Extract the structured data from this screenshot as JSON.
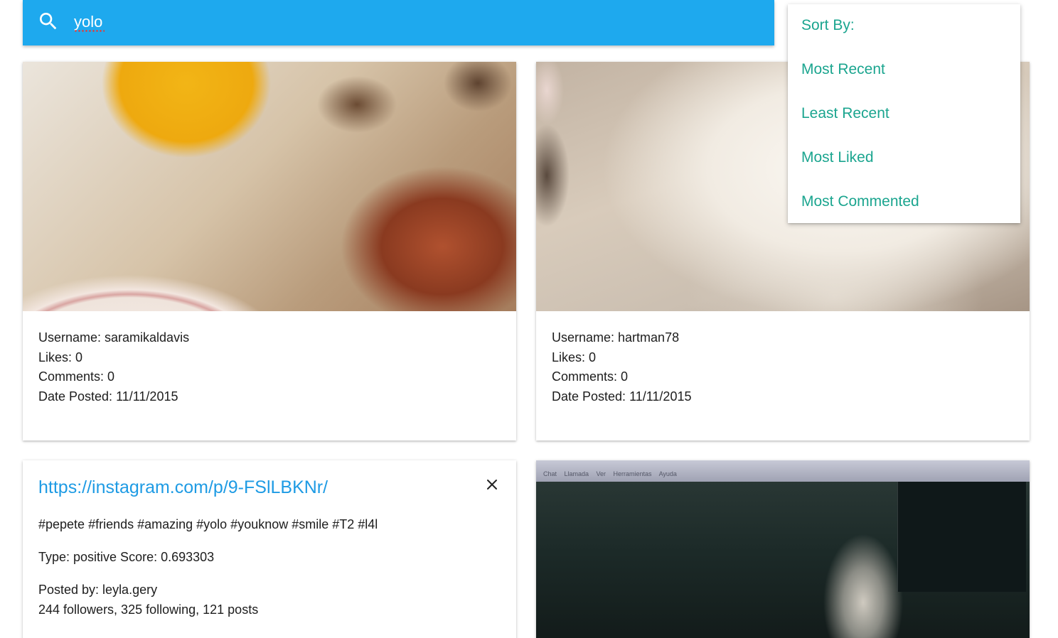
{
  "search": {
    "query": "yolo"
  },
  "sort_menu": {
    "title": "Sort By:",
    "options": [
      "Most Recent",
      "Least Recent",
      "Most Liked",
      "Most Commented"
    ]
  },
  "posts": [
    {
      "username_line": "Username: saramikaldavis",
      "likes_line": "Likes: 0",
      "comments_line": "Comments: 0",
      "date_line": "Date Posted: 11/11/2015"
    },
    {
      "username_line": "Username: hartman78",
      "likes_line": "Likes: 0",
      "comments_line": "Comments: 0",
      "date_line": "Date Posted: 11/11/2015"
    }
  ],
  "detail": {
    "link": "https://instagram.com/p/9-FSlLBKNr/",
    "hashtags": "#pepete #friends #amazing #yolo #youknow #smile #T2 #l4l",
    "sentiment": "Type: positive Score: 0.693303",
    "posted_by": "Posted by: leyla.gery",
    "stats": "244 followers, 325 following, 121 posts"
  },
  "video_chat": {
    "menu": "Chat Llamada Ver Herramientas Ayuda"
  },
  "colors": {
    "search_bar": "#1ea9ee",
    "accent_teal": "#1ba58f",
    "link_blue": "#1e9be4"
  }
}
